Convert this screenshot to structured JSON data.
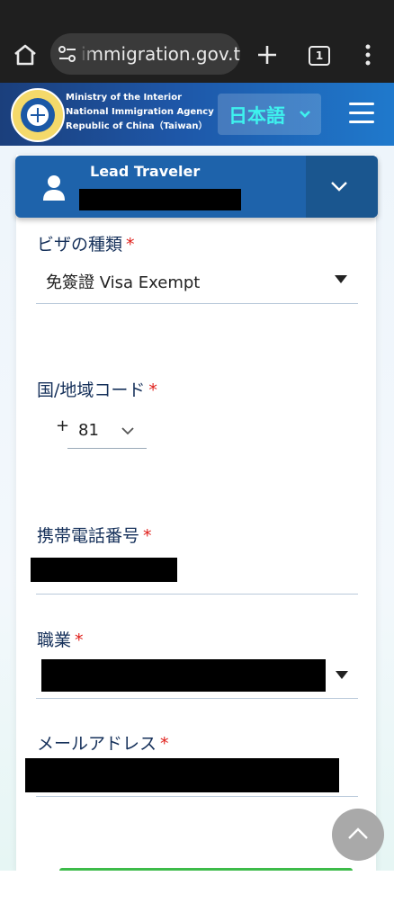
{
  "browser": {
    "url": "immigration.gov.tw",
    "tab_count": "1"
  },
  "header": {
    "agency_line1": "Ministry of the Interior",
    "agency_line2": "National Immigration Agency",
    "agency_line3": "Republic of China（Taiwan）",
    "language": "日本語"
  },
  "traveler": {
    "title": "Lead Traveler"
  },
  "form": {
    "visa_type_label": "ビザの種類",
    "visa_type_value": "免簽證 Visa Exempt",
    "country_code_label": "国/地域コード",
    "country_code_prefix": "+",
    "country_code_value": "81",
    "mobile_label": "携帯電話番号",
    "occupation_label": "職業",
    "email_label": "メールアドレス",
    "required_mark": "*"
  },
  "colors": {
    "header_blue": "#1e63ab",
    "required_red": "#e0201b",
    "language_cyan": "#3ef2ee",
    "submit_green": "#3dbb4a"
  },
  "icons": [
    "home-icon",
    "tune-icon",
    "plus-icon",
    "tabs-icon",
    "kebab-menu-icon",
    "chevron-down-icon",
    "hamburger-menu-icon",
    "person-icon",
    "caret-down-icon",
    "chevron-up-icon"
  ]
}
